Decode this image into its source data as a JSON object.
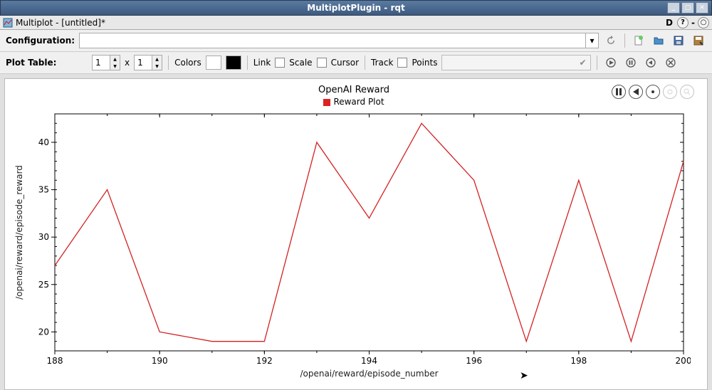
{
  "titlebar": {
    "title": "MultiplotPlugin - rqt"
  },
  "menubar": {
    "doc_title": "Multiplot - [untitled]*",
    "d_label": "D"
  },
  "config_row": {
    "label": "Configuration:"
  },
  "plot_table": {
    "label": "Plot Table:",
    "rows": "1",
    "cols": "1",
    "x": "x",
    "colors_label": "Colors",
    "link_label": "Link",
    "scale_label": "Scale",
    "cursor_label": "Cursor",
    "track_label": "Track",
    "points_label": "Points",
    "color1": "#ffffff",
    "color2": "#000000"
  },
  "plot": {
    "title": "OpenAI Reward",
    "legend": "Reward Plot",
    "legend_color": "#d22222"
  },
  "chart_data": {
    "type": "line",
    "title": "OpenAI Reward",
    "series": [
      {
        "name": "Reward Plot",
        "color": "#d22222",
        "x": [
          188,
          189,
          190,
          191,
          192,
          193,
          194,
          195,
          196,
          197,
          198,
          199,
          200
        ],
        "y": [
          27,
          35,
          20,
          19,
          19,
          40,
          32,
          42,
          36,
          19,
          36,
          19,
          38
        ]
      }
    ],
    "xlabel": "/openai/reward/episode_number",
    "ylabel": "/openai/reward/episode_reward",
    "xlim": [
      188,
      200
    ],
    "ylim": [
      18,
      43
    ],
    "xticks": [
      188,
      190,
      192,
      194,
      196,
      198,
      200
    ],
    "yticks": [
      20,
      25,
      30,
      35,
      40
    ]
  }
}
